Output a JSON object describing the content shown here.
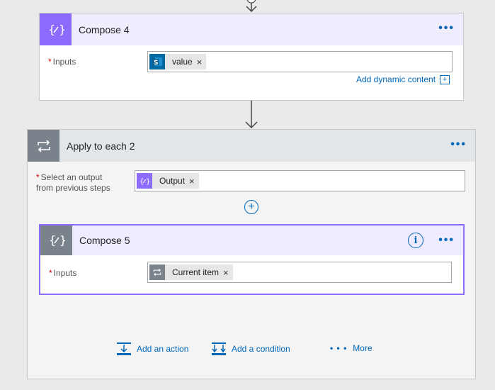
{
  "colors": {
    "accent": "#0067b8",
    "compose_icon_bg": "#8c6cff",
    "loop_icon_bg": "#7a828b"
  },
  "compose4": {
    "title": "Compose 4",
    "more_label": "•••",
    "inputs_label": "Inputs",
    "required_mark": "*",
    "token": {
      "icon": "sharepoint-icon",
      "text": "value",
      "remove": "×"
    },
    "add_dynamic_label": "Add dynamic content",
    "add_dynamic_icon": "+"
  },
  "apply_to_each": {
    "title": "Apply to each 2",
    "more_label": "•••",
    "select_label_line1": "Select an output",
    "select_label_line2": "from previous steps",
    "required_mark": "*",
    "token": {
      "icon": "compose-icon",
      "text": "Output",
      "remove": "×"
    },
    "add_step_icon": "+"
  },
  "compose5": {
    "title": "Compose 5",
    "info_label": "i",
    "more_label": "•••",
    "inputs_label": "Inputs",
    "required_mark": "*",
    "token": {
      "icon": "loop-icon",
      "text": "Current item",
      "remove": "×"
    }
  },
  "actions": {
    "add_action": "Add an action",
    "add_condition": "Add a condition",
    "more": "More",
    "more_dots": "• • •"
  }
}
